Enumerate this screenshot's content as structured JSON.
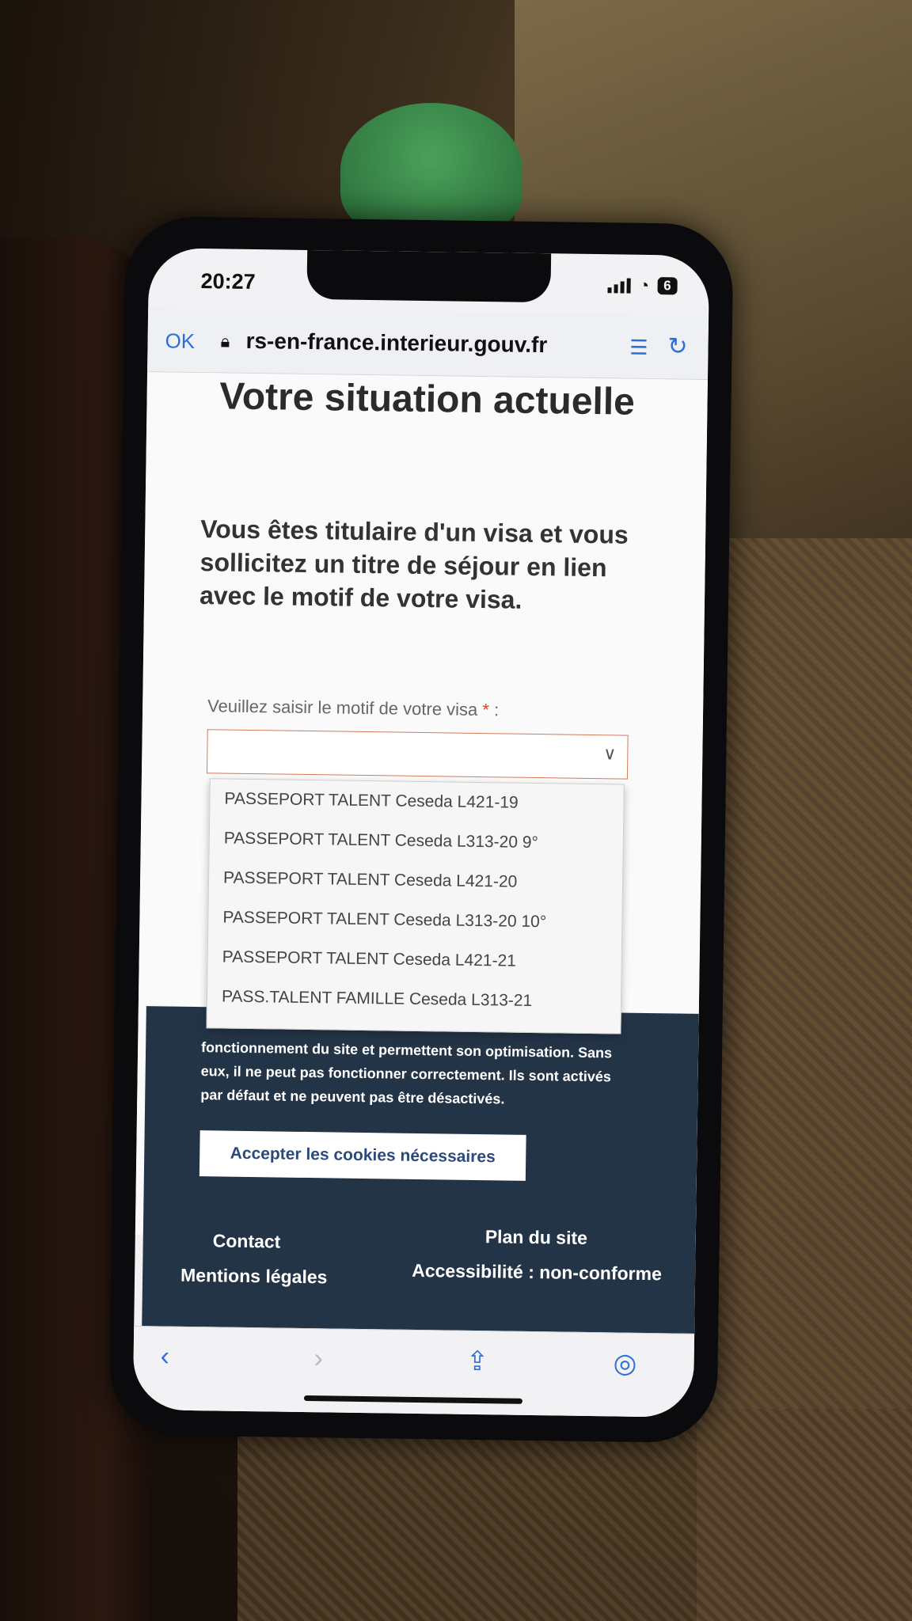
{
  "status": {
    "time": "20:27",
    "battery": "6"
  },
  "browser": {
    "done_label": "OK",
    "url": "rs-en-france.interieur.gouv.fr"
  },
  "page": {
    "title": "Votre situation actuelle",
    "subheading": "Vous êtes titulaire d'un visa et vous sollicitez un titre de séjour en lien avec le motif de votre visa.",
    "field_label": "Veuillez saisir le motif de votre visa",
    "required_mark": "*",
    "label_suffix": " :",
    "select_value": ""
  },
  "dropdown": {
    "options": [
      "PASSEPORT TALENT Ceseda L421-19",
      "PASSEPORT TALENT Ceseda L313-20 9°",
      "PASSEPORT TALENT Ceseda L421-20",
      "PASSEPORT TALENT Ceseda L313-20 10°",
      "PASSEPORT TALENT Ceseda L421-21",
      "PASS.TALENT FAMILLE Ceseda L313-21"
    ]
  },
  "cookies": {
    "text": "fonctionnement du site et permettent son optimisation. Sans eux, il ne peut pas fonctionner correctement. Ils sont activés par défaut et ne peuvent pas être désactivés.",
    "accept_label": "Accepter les cookies nécessaires"
  },
  "footer": {
    "contact": "Contact",
    "sitemap": "Plan du site",
    "legal": "Mentions légales",
    "accessibility": "Accessibilité : non-conforme"
  },
  "icons": {
    "back": "chevron-left-icon",
    "forward": "chevron-right-icon",
    "share": "share-icon",
    "compass": "compass-icon",
    "reader": "reader-icon",
    "reload": "reload-icon",
    "lock": "lock-icon"
  },
  "colors": {
    "accent": "#2e6fd6",
    "footer_bg": "#243447",
    "required": "#d2452b"
  }
}
